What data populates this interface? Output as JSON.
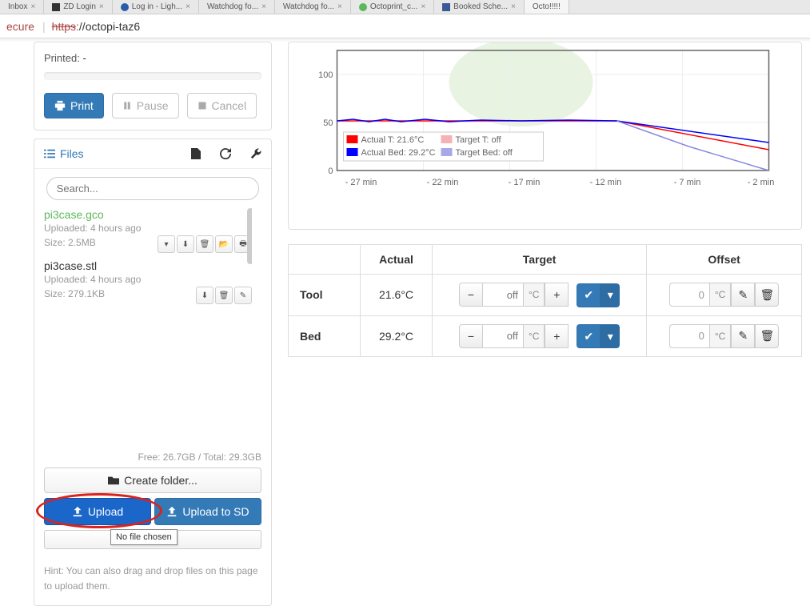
{
  "url": {
    "secure_label": "ecure",
    "protocol": "https",
    "host": "//octopi-taz6"
  },
  "tabs": [
    {
      "label": "Inbox"
    },
    {
      "label": "ZD Login"
    },
    {
      "label": "Log in - Ligh..."
    },
    {
      "label": "Watchdog fo..."
    },
    {
      "label": "Watchdog fo..."
    },
    {
      "label": "Octoprint_c..."
    },
    {
      "label": "Booked Sche..."
    },
    {
      "label": "Octo!!!!!"
    }
  ],
  "state": {
    "printed_label": "Printed:",
    "printed_value": "-",
    "print_btn": "Print",
    "pause_btn": "Pause",
    "cancel_btn": "Cancel"
  },
  "files": {
    "title": "Files",
    "search_ph": "Search...",
    "items": [
      {
        "name": "pi3case.gco",
        "uploaded": "Uploaded: 4 hours ago",
        "size": "Size: 2.5MB",
        "green": true,
        "actions": 5
      },
      {
        "name": "pi3case.stl",
        "uploaded": "Uploaded: 4 hours ago",
        "size": "Size: 279.1KB",
        "green": false,
        "actions": 3
      }
    ],
    "storage": "Free: 26.7GB / Total: 29.3GB",
    "create_folder": "Create folder...",
    "upload": "Upload",
    "upload_sd": "Upload to SD",
    "no_file": "No file chosen",
    "hint": "Hint: You can also drag and drop files on this page to upload them."
  },
  "chart_data": {
    "type": "line",
    "x_ticks": [
      "- 27 min",
      "- 22 min",
      "- 17 min",
      "- 12 min",
      "- 7 min",
      "- 2 min"
    ],
    "y_ticks": [
      0,
      50,
      100
    ],
    "series": [
      {
        "name": "Actual T: 21.6°C",
        "color": "#ff0000"
      },
      {
        "name": "Target T: off",
        "color": "#f5b2b2"
      },
      {
        "name": "Actual Bed: 29.2°C",
        "color": "#0000ff"
      },
      {
        "name": "Target Bed: off",
        "color": "#a8a8e8"
      }
    ],
    "actual_t": [
      51,
      51,
      51,
      51,
      51,
      44,
      21.6
    ],
    "actual_bed": [
      51,
      51,
      51,
      51,
      51,
      46,
      29.2
    ],
    "target_t": [
      0,
      0,
      0,
      0,
      0,
      0,
      0
    ],
    "target_bed": [
      null,
      null,
      null,
      null,
      51,
      25,
      0
    ],
    "ylim": [
      0,
      110
    ]
  },
  "temp": {
    "headers": {
      "actual": "Actual",
      "target": "Target",
      "offset": "Offset"
    },
    "rows": [
      {
        "label": "Tool",
        "actual": "21.6°C",
        "target_ph": "off",
        "unit": "°C",
        "offset_val": "0"
      },
      {
        "label": "Bed",
        "actual": "29.2°C",
        "target_ph": "off",
        "unit": "°C",
        "offset_val": "0"
      }
    ]
  }
}
